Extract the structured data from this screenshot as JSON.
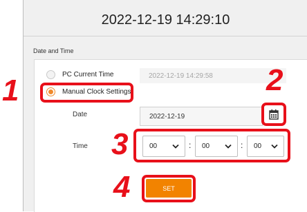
{
  "header": {
    "clock": "2022-12-19 14:29:10"
  },
  "section": {
    "title": "Date and Time"
  },
  "options": {
    "pc_time_label": "PC Current Time",
    "pc_time_value": "2022-12-19 14:29:58",
    "manual_label": "Manual Clock Settings",
    "selected": "manual"
  },
  "date": {
    "label": "Date",
    "value": "2022-12-19"
  },
  "time": {
    "label": "Time",
    "hour": "00",
    "minute": "00",
    "second": "00",
    "separator": ":"
  },
  "set_button": {
    "label": "SET"
  },
  "callouts": [
    "1",
    "2",
    "3",
    "4"
  ],
  "colors": {
    "accent": "#f28300",
    "highlight": "#e8101a"
  },
  "icons": {
    "calendar": "calendar-icon",
    "chevron": "chevron-down-icon"
  }
}
